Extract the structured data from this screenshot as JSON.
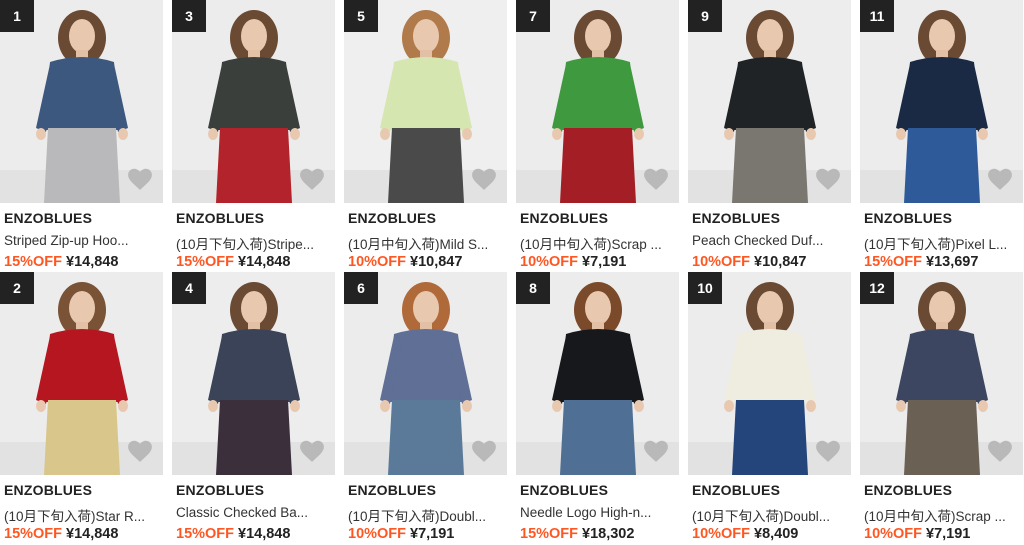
{
  "products": [
    {
      "rank": "1",
      "brand": "ENZOBLUES",
      "title": "Striped Zip-up Hoo...",
      "discount": "15%OFF",
      "price": "¥14,848",
      "colors": {
        "bg": "#ececec",
        "top": "#3d587e",
        "bottom": "#b9b9bb",
        "hair": "#6b4a33"
      }
    },
    {
      "rank": "3",
      "brand": "ENZOBLUES",
      "title": "(10月下旬入荷)Stripe...",
      "discount": "15%OFF",
      "price": "¥14,848",
      "colors": {
        "bg": "#ececec",
        "top": "#3b3f3c",
        "bottom": "#b3232b",
        "hair": "#6b4a33"
      }
    },
    {
      "rank": "5",
      "brand": "ENZOBLUES",
      "title": "(10月中旬入荷)Mild S...",
      "discount": "10%OFF",
      "price": "¥10,847",
      "colors": {
        "bg": "#efefef",
        "top": "#d6e6b0",
        "bottom": "#4a4a4a",
        "hair": "#b07a4a"
      }
    },
    {
      "rank": "7",
      "brand": "ENZOBLUES",
      "title": "(10月中旬入荷)Scrap ...",
      "discount": "10%OFF",
      "price": "¥7,191",
      "colors": {
        "bg": "#ececec",
        "top": "#3f9a3f",
        "bottom": "#a31f25",
        "hair": "#6b4a33"
      }
    },
    {
      "rank": "9",
      "brand": "ENZOBLUES",
      "title": "Peach Checked Duf...",
      "discount": "10%OFF",
      "price": "¥10,847",
      "colors": {
        "bg": "#ededed",
        "top": "#1f2326",
        "bottom": "#7a7770",
        "hair": "#6b4a33"
      }
    },
    {
      "rank": "11",
      "brand": "ENZOBLUES",
      "title": "(10月下旬入荷)Pixel L...",
      "discount": "15%OFF",
      "price": "¥13,697",
      "colors": {
        "bg": "#ececec",
        "top": "#1b2a44",
        "bottom": "#2f5a9a",
        "hair": "#6b4a33"
      }
    },
    {
      "rank": "2",
      "brand": "ENZOBLUES",
      "title": "(10月下旬入荷)Star R...",
      "discount": "15%OFF",
      "price": "¥14,848",
      "colors": {
        "bg": "#ececec",
        "top": "#b5161f",
        "bottom": "#d9c68a",
        "hair": "#7a5236"
      }
    },
    {
      "rank": "4",
      "brand": "ENZOBLUES",
      "title": "Classic Checked Ba...",
      "discount": "15%OFF",
      "price": "¥14,848",
      "colors": {
        "bg": "#ededed",
        "top": "#3b4358",
        "bottom": "#3a2f3a",
        "hair": "#6b4a33"
      }
    },
    {
      "rank": "6",
      "brand": "ENZOBLUES",
      "title": "(10月下旬入荷)Doubl...",
      "discount": "10%OFF",
      "price": "¥7,191",
      "colors": {
        "bg": "#ececec",
        "top": "#5f6f95",
        "bottom": "#5b7a9a",
        "hair": "#b06a3a"
      }
    },
    {
      "rank": "8",
      "brand": "ENZOBLUES",
      "title": "Needle Logo High-n...",
      "discount": "15%OFF",
      "price": "¥18,302",
      "colors": {
        "bg": "#ececec",
        "top": "#16181b",
        "bottom": "#4f6f95",
        "hair": "#7a4a2a"
      }
    },
    {
      "rank": "10",
      "brand": "ENZOBLUES",
      "title": "(10月下旬入荷)Doubl...",
      "discount": "10%OFF",
      "price": "¥8,409",
      "colors": {
        "bg": "#ececec",
        "top": "#efece0",
        "bottom": "#24457c",
        "hair": "#6b4a33"
      }
    },
    {
      "rank": "12",
      "brand": "ENZOBLUES",
      "title": "(10月中旬入荷)Scrap ...",
      "discount": "10%OFF",
      "price": "¥7,191",
      "colors": {
        "bg": "#ececec",
        "top": "#3c4660",
        "bottom": "#6a6054",
        "hair": "#6b4a33"
      }
    }
  ],
  "icons": {
    "favorite": "heart-icon"
  },
  "colors": {
    "rank_badge": "#222222",
    "discount": "#ff5722",
    "heart": "#b9b9b9"
  }
}
